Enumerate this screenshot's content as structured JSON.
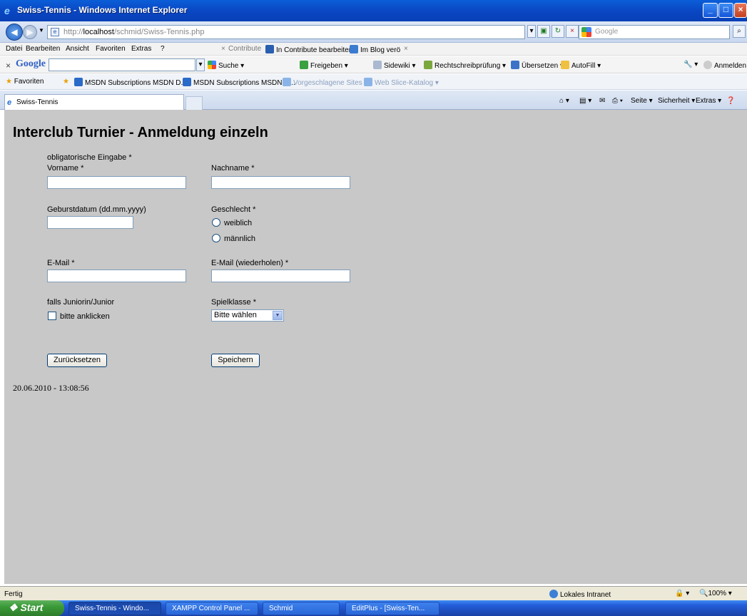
{
  "window": {
    "title": "Swiss-Tennis - Windows Internet Explorer"
  },
  "address": {
    "url_prefix": "http://",
    "url_host": "localhost",
    "url_path": "/schmid/Swiss-Tennis.php"
  },
  "search_box": {
    "placeholder": "Google"
  },
  "menu": [
    "Datei",
    "Bearbeiten",
    "Ansicht",
    "Favoriten",
    "Extras",
    "?"
  ],
  "contribute": {
    "close": "×",
    "contribute": "Contribute",
    "edit": "In Contribute bearbeiten",
    "blog": "Im Blog verö"
  },
  "google_bar": {
    "close": "×",
    "logo": "Google",
    "search": "Suche",
    "share": "Freigeben",
    "sidewiki": "Sidewiki",
    "spell": "Rechtschreibprüfung",
    "translate": "Übersetzen",
    "autofill": "AutoFill",
    "signin": "Anmelden"
  },
  "favorites": {
    "label": "Favoriten",
    "items": [
      "MSDN Subscriptions MSDN D...",
      "MSDN Subscriptions MSDN D...",
      "Vorgeschlagene Sites",
      "Web Slice-Katalog"
    ]
  },
  "tab": {
    "label": "Swiss-Tennis"
  },
  "commandbar": {
    "page": "Seite",
    "safety": "Sicherheit",
    "tools": "Extras"
  },
  "form": {
    "title": "Interclub Turnier - Anmeldung einzeln",
    "required_note": "obligatorische Eingabe *",
    "firstname_label": "Vorname *",
    "lastname_label": "Nachname *",
    "birthdate_label": "Geburstdatum (dd.mm.yyyy)",
    "gender_label": "Geschlecht *",
    "gender_female": "weiblich",
    "gender_male": "männlich",
    "email_label": "E-Mail *",
    "email_repeat_label": "E-Mail (wiederholen) *",
    "junior_label": "falls Juniorin/Junior",
    "junior_checkbox": "bitte anklicken",
    "class_label": "Spielklasse *",
    "class_selected": "Bitte wählen",
    "reset_button": "Zurücksetzen",
    "save_button": "Speichern",
    "timestamp": "20.06.2010 - 13:08:56"
  },
  "status": {
    "left": "Fertig",
    "zone": "Lokales Intranet",
    "zoom": "100%"
  },
  "taskbar": {
    "start": "Start",
    "tasks": [
      "Swiss-Tennis - Windo...",
      "XAMPP Control Panel ...",
      "Schmid",
      "EditPlus - [Swiss-Ten..."
    ]
  }
}
